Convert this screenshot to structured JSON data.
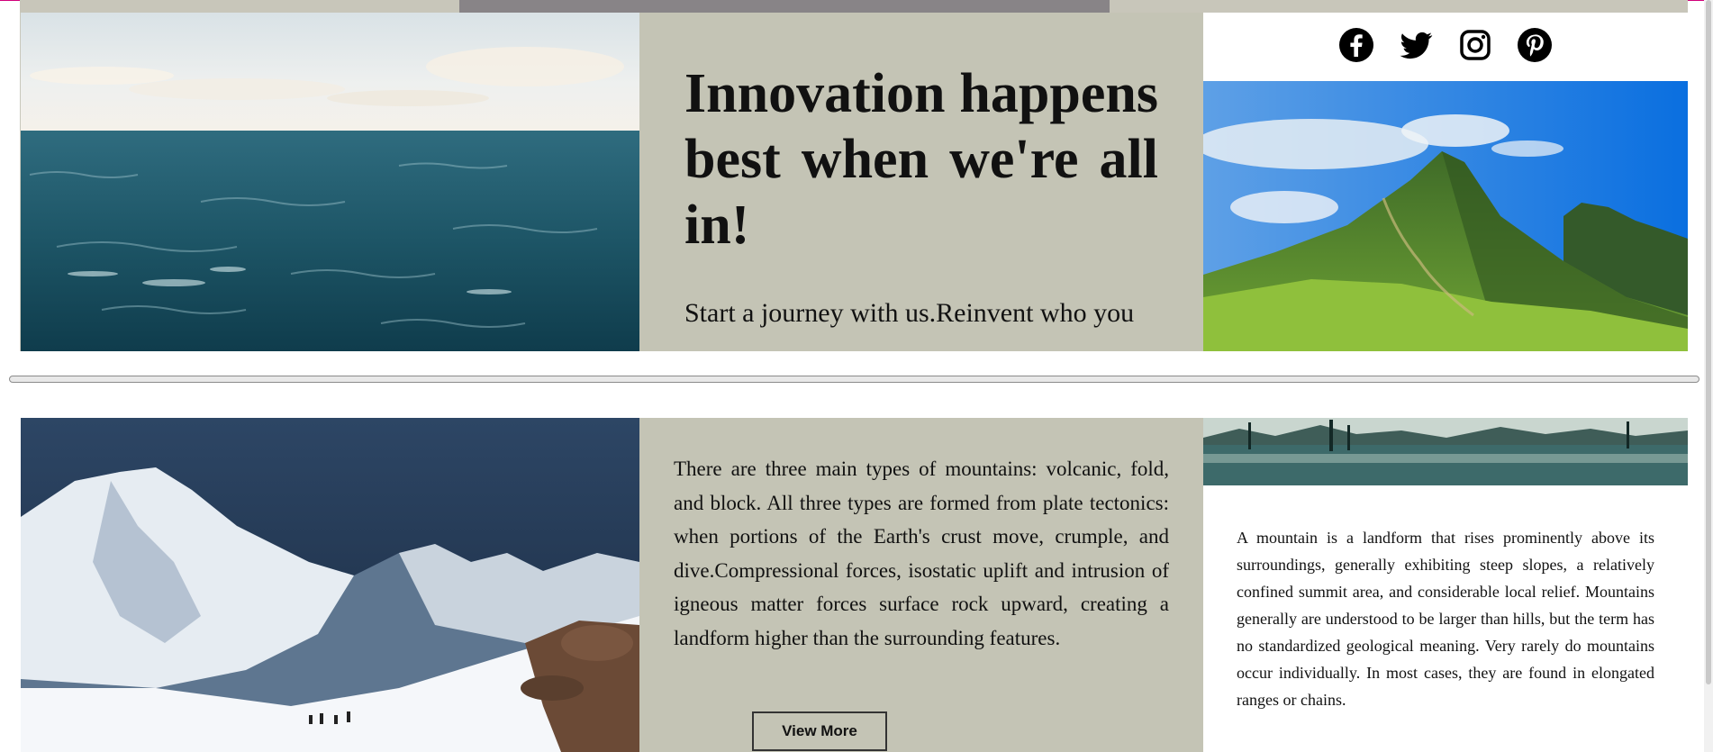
{
  "hero": {
    "title": "Innovation happens best when we're all in!",
    "subtitle": "Start a journey with us.Reinvent who you"
  },
  "social": {
    "icons": [
      "facebook-icon",
      "twitter-icon",
      "instagram-icon",
      "pinterest-icon"
    ]
  },
  "scroll_progress": 0.39,
  "section2": {
    "mountain_types_text": "There are three main types of mountains: volcanic, fold, and block. All three types are formed from plate tectonics: when portions of the Earth's crust move, crumple, and dive.Compressional forces, isostatic uplift and intrusion of igneous matter forces surface rock upward, creating a landform higher than the surrounding features.",
    "view_more_label": "View More",
    "mountain_description": "A mountain is a landform that rises prominently above its surroundings, generally exhibiting steep slopes, a relatively confined summit area, and considerable local relief. Mountains generally are understood to be larger than hills, but the term has no standardized geological meaning. Very rarely do mountains occur individually. In most cases, they are found in elongated ranges or chains."
  },
  "colors": {
    "panel": "#c4c4b5",
    "progress_track": "#c8c6ba",
    "progress_fill": "#888487"
  }
}
